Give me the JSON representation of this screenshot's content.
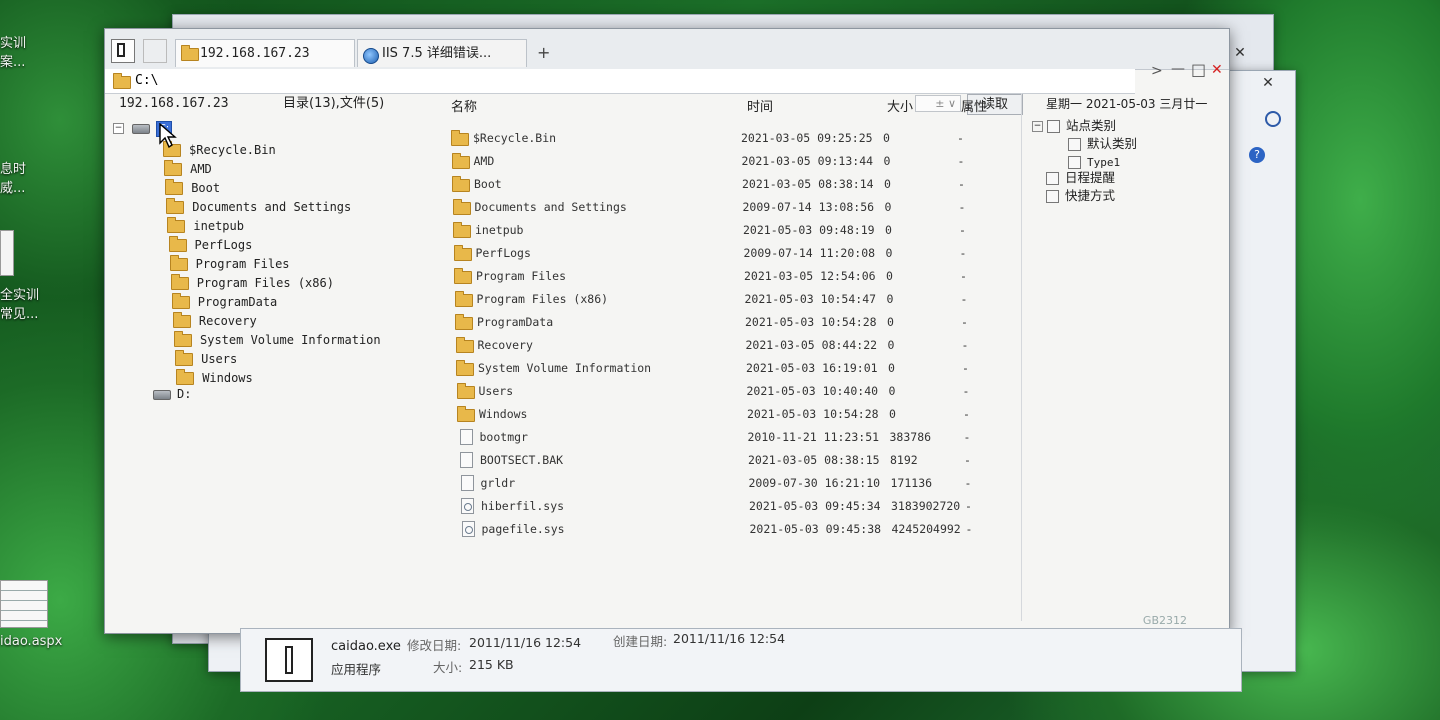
{
  "desktop": {
    "icons": [
      {
        "label": "实训\n案..."
      },
      {
        "label": "息时\n威..."
      },
      {
        "label": "全实训\n常见..."
      },
      {
        "label": "idao.aspx"
      }
    ]
  },
  "window": {
    "tabs": [
      {
        "label": "192.168.167.23",
        "icon": "folder-icon"
      },
      {
        "label": "IIS 7.5 详细错误...",
        "icon": "globe-icon"
      }
    ],
    "new_tab": "+",
    "address": "C:\\",
    "controls": {
      "back": "<",
      "forward": ">",
      "minimize": "—",
      "maximize": "□",
      "close": "✕"
    }
  },
  "toolbar": {
    "host": "192.168.167.23",
    "summary": "目录(13),文件(5)",
    "selector": "± ∨",
    "read_button": "读取",
    "date": "星期一  2021-05-03  三月廿一"
  },
  "tree": {
    "drive_c": "C:",
    "folders": [
      "$Recycle.Bin",
      "AMD",
      "Boot",
      "Documents and Settings",
      "inetpub",
      "PerfLogs",
      "Program Files",
      "Program Files (x86)",
      "ProgramData",
      "Recovery",
      "System Volume Information",
      "Users",
      "Windows"
    ],
    "drive_d": "D:"
  },
  "list": {
    "headers": {
      "name": "名称",
      "time": "时间",
      "size": "大小",
      "attr": "属性"
    },
    "rows": [
      {
        "name": "$Recycle.Bin",
        "time": "2021-03-05 09:25:25",
        "size": "0",
        "attr": "-",
        "type": "folder"
      },
      {
        "name": "AMD",
        "time": "2021-03-05 09:13:44",
        "size": "0",
        "attr": "-",
        "type": "folder"
      },
      {
        "name": "Boot",
        "time": "2021-03-05 08:38:14",
        "size": "0",
        "attr": "-",
        "type": "folder"
      },
      {
        "name": "Documents and Settings",
        "time": "2009-07-14 13:08:56",
        "size": "0",
        "attr": "-",
        "type": "folder"
      },
      {
        "name": "inetpub",
        "time": "2021-05-03 09:48:19",
        "size": "0",
        "attr": "-",
        "type": "folder"
      },
      {
        "name": "PerfLogs",
        "time": "2009-07-14 11:20:08",
        "size": "0",
        "attr": "-",
        "type": "folder"
      },
      {
        "name": "Program Files",
        "time": "2021-03-05 12:54:06",
        "size": "0",
        "attr": "-",
        "type": "folder"
      },
      {
        "name": "Program Files (x86)",
        "time": "2021-05-03 10:54:47",
        "size": "0",
        "attr": "-",
        "type": "folder"
      },
      {
        "name": "ProgramData",
        "time": "2021-05-03 10:54:28",
        "size": "0",
        "attr": "-",
        "type": "folder"
      },
      {
        "name": "Recovery",
        "time": "2021-03-05 08:44:22",
        "size": "0",
        "attr": "-",
        "type": "folder"
      },
      {
        "name": "System Volume Information",
        "time": "2021-05-03 16:19:01",
        "size": "0",
        "attr": "-",
        "type": "folder"
      },
      {
        "name": "Users",
        "time": "2021-05-03 10:40:40",
        "size": "0",
        "attr": "-",
        "type": "folder"
      },
      {
        "name": "Windows",
        "time": "2021-05-03 10:54:28",
        "size": "0",
        "attr": "-",
        "type": "folder"
      },
      {
        "name": "bootmgr",
        "time": "2010-11-21 11:23:51",
        "size": "383786",
        "attr": "-",
        "type": "file"
      },
      {
        "name": "BOOTSECT.BAK",
        "time": "2021-03-05 08:38:15",
        "size": "8192",
        "attr": "-",
        "type": "file"
      },
      {
        "name": "grldr",
        "time": "2009-07-30 16:21:10",
        "size": "171136",
        "attr": "-",
        "type": "file"
      },
      {
        "name": "hiberfil.sys",
        "time": "2021-05-03 09:45:34",
        "size": "3183902720",
        "attr": "-",
        "type": "sys"
      },
      {
        "name": "pagefile.sys",
        "time": "2021-05-03 09:45:38",
        "size": "4245204992",
        "attr": "-",
        "type": "sys"
      }
    ]
  },
  "right_panel": {
    "site_category": "站点类别",
    "default_category": "默认类别",
    "type1": "Type1",
    "schedule": "日程提醒",
    "shortcut": "快捷方式"
  },
  "status": {
    "encoding": "GB2312"
  },
  "details": {
    "filename": "caidao.exe",
    "type": "应用程序",
    "modified_label": "修改日期:",
    "modified_value": "2011/11/16 12:54",
    "created_label": "创建日期:",
    "created_value": "2011/11/16 12:54",
    "size_label": "大小:",
    "size_value": "215 KB"
  },
  "colors": {
    "accent": "#3a6fd8",
    "folder": "#e8b84a",
    "desktop": "#1b6e28"
  }
}
